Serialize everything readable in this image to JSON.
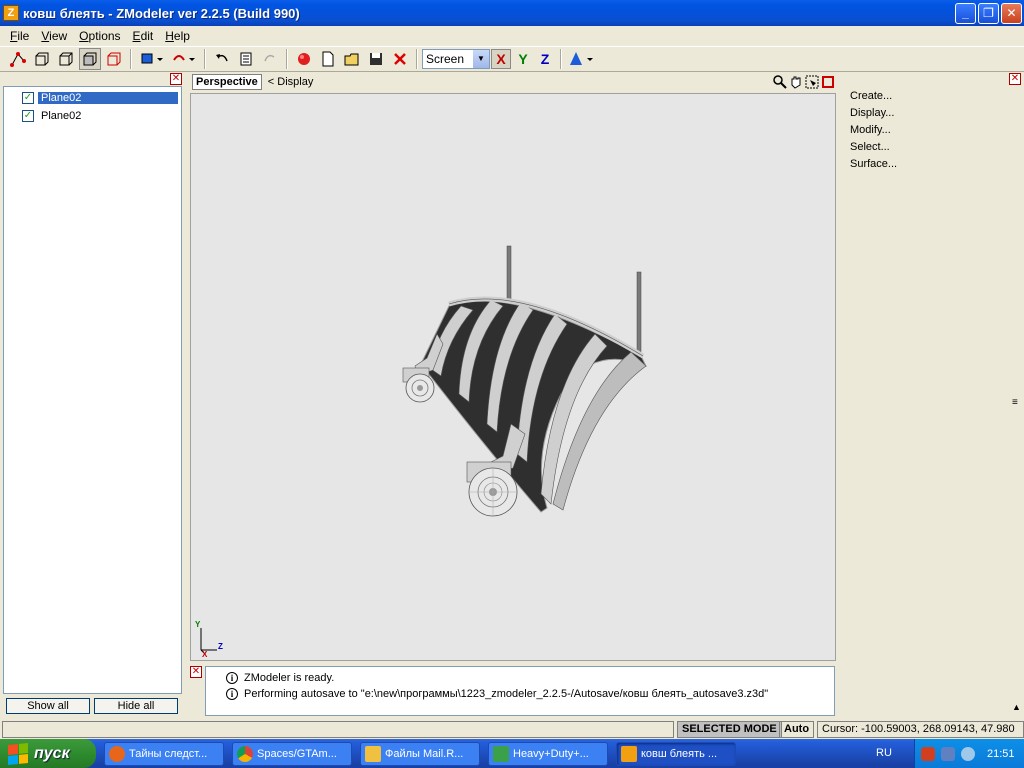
{
  "window": {
    "title": "ковш блеять - ZModeler ver 2.2.5 (Build 990)",
    "app_icon": "Z",
    "min_label": "_",
    "restore_label": "❐",
    "close_label": "✕"
  },
  "menu": {
    "items": [
      {
        "label": "File",
        "accel": "F",
        "rest": "ile"
      },
      {
        "label": "View",
        "accel": "V",
        "rest": "iew"
      },
      {
        "label": "Options",
        "accel": "O",
        "rest": "ptions"
      },
      {
        "label": "Edit",
        "accel": "E",
        "rest": "dit"
      },
      {
        "label": "Help",
        "accel": "H",
        "rest": "elp"
      }
    ]
  },
  "toolbar": {
    "view_mode": "Screen",
    "axis_x": "X",
    "axis_y": "Y",
    "axis_z": "Z"
  },
  "tree": {
    "items": [
      {
        "label": "Plane02",
        "checked": true,
        "selected": true
      },
      {
        "label": "Plane02",
        "checked": true,
        "selected": false
      }
    ],
    "check_glyph": "✓",
    "show_all": "Show all",
    "hide_all": "Hide all"
  },
  "viewport": {
    "tab": "Perspective",
    "display_label": "< Display",
    "axis_y": "Y",
    "axis_z": "Z",
    "axis_x": "X"
  },
  "log": {
    "lines": [
      "ZModeler is ready.",
      "Performing autosave to \"e:\\new\\программы\\1223_zmodeler_2.2.5-/Autosave/ковш блеять_autosave3.z3d\""
    ]
  },
  "commands": {
    "items": [
      "Create...",
      "Display...",
      "Modify...",
      "Select...",
      "Surface..."
    ]
  },
  "status": {
    "mode": "SELECTED MODE",
    "auto": "Auto",
    "cursor": "Cursor: -100.59003, 268.09143, 47.980"
  },
  "taskbar": {
    "start": "пуск",
    "tasks": [
      {
        "label": "Тайны следст...",
        "color": "#e8661a"
      },
      {
        "label": "Spaces/GTAm...",
        "color": "#4aa04a"
      },
      {
        "label": "Файлы Mail.R...",
        "color": "#f0c040"
      },
      {
        "label": "Heavy+Duty+...",
        "color": "#3aa04a"
      },
      {
        "label": "ковш блеять ...",
        "color": "#f0a010"
      }
    ],
    "lang": "RU",
    "clock": "21:51"
  }
}
